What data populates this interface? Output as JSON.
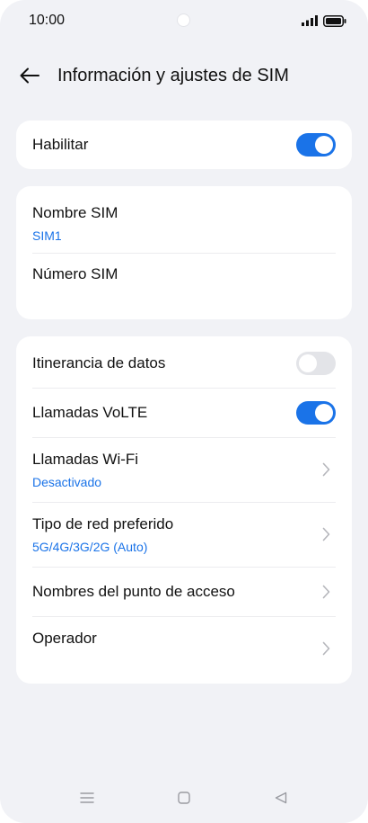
{
  "status_bar": {
    "time": "10:00"
  },
  "header": {
    "title": "Información y ajustes de SIM"
  },
  "enable": {
    "label": "Habilitar",
    "value": true
  },
  "sim_name": {
    "label": "Nombre SIM",
    "value": "SIM1"
  },
  "sim_number": {
    "label": "Número SIM"
  },
  "network": {
    "roaming": {
      "label": "Itinerancia de datos",
      "value": false
    },
    "volte": {
      "label": "Llamadas VoLTE",
      "value": true
    },
    "wifi_calling": {
      "label": "Llamadas Wi-Fi",
      "value": "Desactivado"
    },
    "preferred_network": {
      "label": "Tipo de red preferido",
      "value": "5G/4G/3G/2G (Auto)"
    },
    "apn": {
      "label": "Nombres del punto de acceso"
    },
    "operator": {
      "label": "Operador"
    }
  },
  "colors": {
    "accent": "#1a73e8",
    "background": "#f1f2f6",
    "toggle_off": "#e3e4e8"
  },
  "icons": [
    "back-arrow-icon",
    "signal-icon",
    "battery-icon",
    "chevron-right-icon",
    "menu-icon",
    "home-icon",
    "back-icon"
  ]
}
